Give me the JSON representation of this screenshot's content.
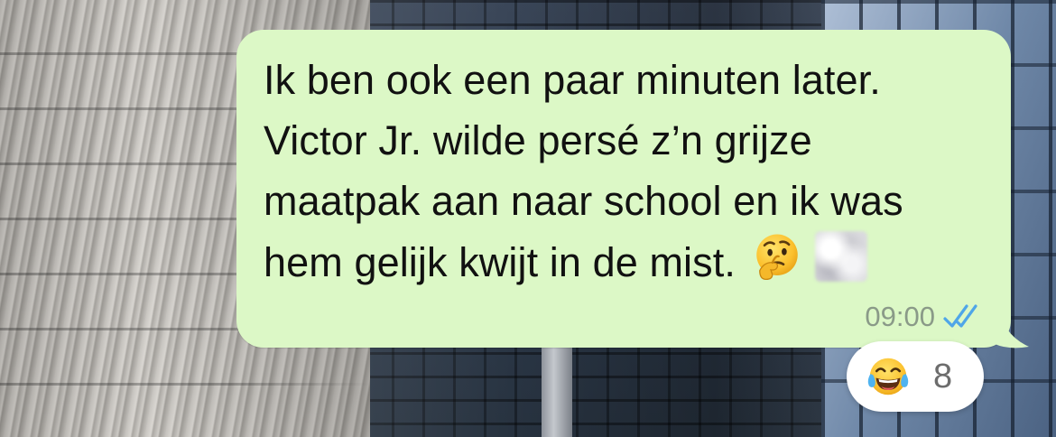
{
  "message": {
    "lines": [
      "Ik ben ook een paar minuten later.",
      "Victor Jr. wilde persé z’n grijze",
      "maatpak aan naar school en ik was",
      "hem gelijk kwijt in de mist."
    ],
    "trailing_emojis": [
      "thinking-face-emoji",
      "blurred-emoji"
    ],
    "time": "09:00",
    "status_icon": "double-check-read-icon",
    "bubble_color": "#dcf8c6",
    "read_receipt_color": "#4fa6e8"
  },
  "reaction": {
    "emoji": "face-with-tears-of-joy-emoji",
    "count": "8"
  }
}
